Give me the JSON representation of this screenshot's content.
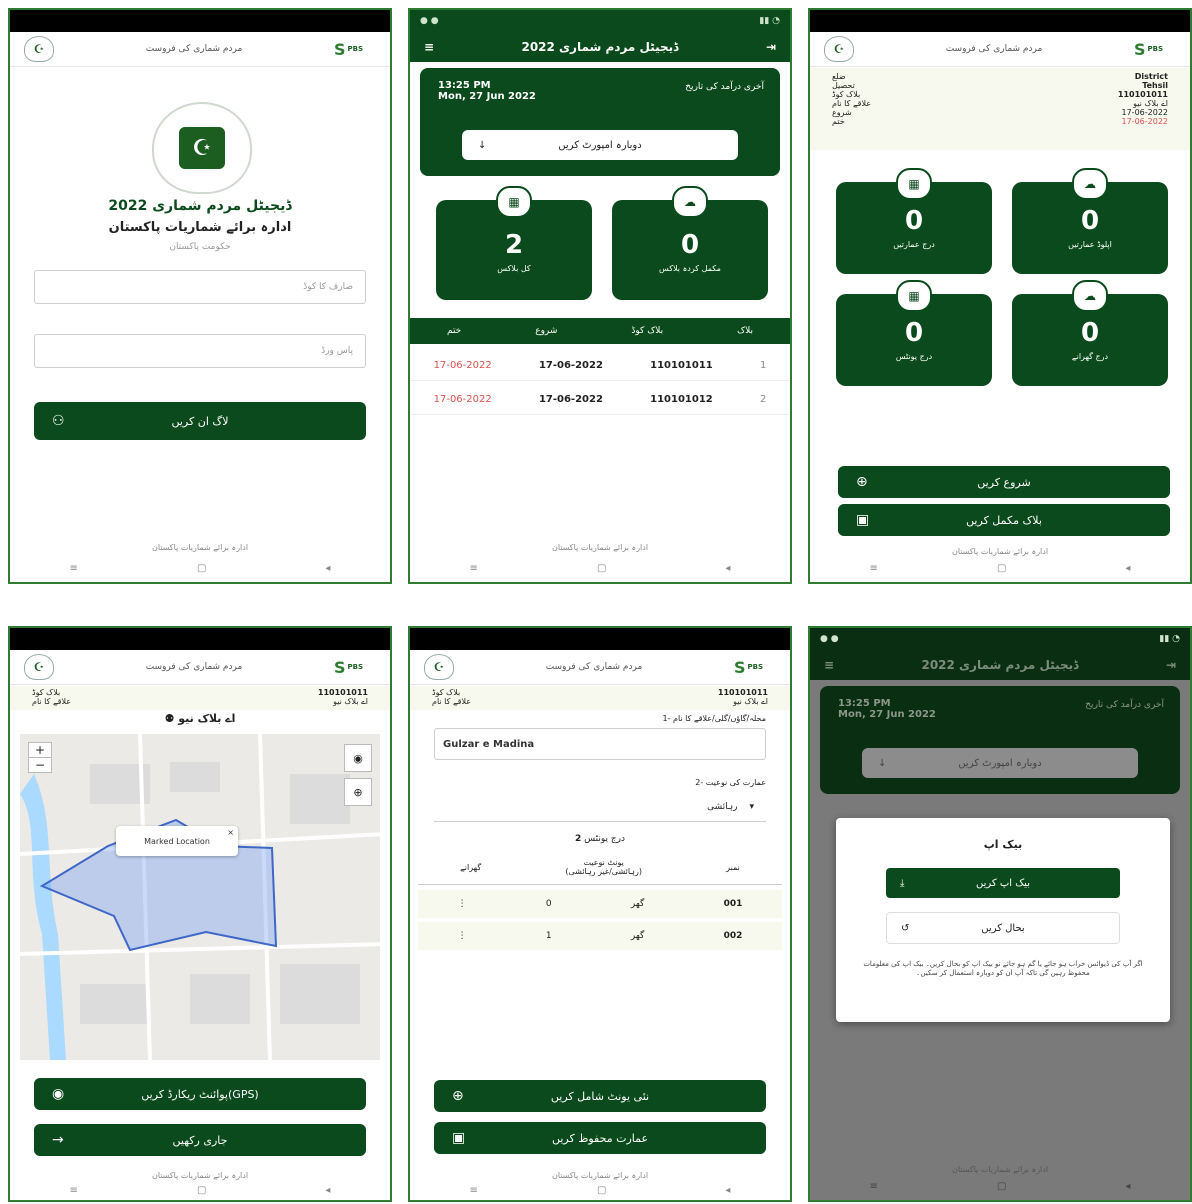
{
  "common": {
    "header_title": "مردم شماری کی فروست",
    "pbs_text": "PBS",
    "footer": "ادارہ برائے شماریات پاکستان",
    "app_title": "ڈیجیٹل مردم شماری 2022"
  },
  "screen1": {
    "title": "ڈیجیٹل مردم شماری 2022",
    "org": "ادارہ برائے شماریات پاکستان",
    "gov": "حکومت پاکستان",
    "username_placeholder": "صارف کا کوڈ",
    "password_placeholder": "پاس ورڈ",
    "login_label": "لاگ ان کریں"
  },
  "screen2": {
    "time": "13:25 PM",
    "date": "Mon, 27 Jun 2022",
    "last_import": "آخری درآمد کی تاریخ",
    "reimport_label": "دوبارہ امپورٹ کریں",
    "card_total_value": "2",
    "card_total_label": "کل بلاکس",
    "card_complete_value": "0",
    "card_complete_label": "مکمل کردہ بلاکس",
    "table_headers": [
      "ختم",
      "شروع",
      "بلاک کوڈ",
      "بلاک"
    ],
    "rows": [
      {
        "end": "17-06-2022",
        "start": "17-06-2022",
        "code": "110101011",
        "idx": "1"
      },
      {
        "end": "17-06-2022",
        "start": "17-06-2022",
        "code": "110101012",
        "idx": "2"
      }
    ]
  },
  "screen3": {
    "info": [
      [
        "ضلع",
        "District"
      ],
      [
        "تحصیل",
        "Tehsil"
      ],
      [
        "بلاک کوڈ",
        "110101011"
      ],
      [
        "علاقے کا نام",
        "اے بلاک نیو"
      ],
      [
        "شروع",
        "17-06-2022"
      ],
      [
        "ختم",
        "17-06-2022"
      ]
    ],
    "cards": [
      {
        "value": "0",
        "label": "درج عمارتیں",
        "icon": "building-icon"
      },
      {
        "value": "0",
        "label": "اپلوڈ عمارتیں",
        "icon": "cloud-upload-icon"
      },
      {
        "value": "0",
        "label": "درج یونٹس",
        "icon": "building-icon"
      },
      {
        "value": "0",
        "label": "درج گھرانے",
        "icon": "cloud-upload-icon"
      }
    ],
    "start_label": "شروع کریں",
    "complete_label": "بلاک مکمل کریں"
  },
  "screen4": {
    "block_code_label": "بلاک کوڈ",
    "block_code_value": "110101011",
    "area_label": "علاقے کا نام",
    "area_value": "اے بلاک نیو",
    "area_name": "اے بلاک نیو",
    "map_popup": "Marked Location",
    "gps_label": "پوائنٹ ریکارڈ کریں(GPS)",
    "continue_label": "جاری رکھیں"
  },
  "screen5": {
    "block_code_label": "بلاک کوڈ",
    "block_code_value": "110101011",
    "area_label": "علاقے کا نام",
    "area_value": "اے بلاک نیو",
    "q1": "1- محلہ/گاؤں/گلی/علاقے کا نام",
    "q1_value": "Gulzar e Madina",
    "q2": "2- عمارت کی نوعیت",
    "q2_value": "رہائشی",
    "units_label": "درج یونٹس",
    "units_count": "2",
    "table_headers": [
      "نمبر",
      "یونٹ نوعیت",
      "گھرانے"
    ],
    "table_sub": "(رہائشی/غیر رہائشی)",
    "rows": [
      {
        "no": "001",
        "type": "گھر",
        "hh": "0"
      },
      {
        "no": "002",
        "type": "گھر",
        "hh": "1"
      }
    ],
    "add_unit_label": "نئی یونٹ شامل کریں",
    "save_label": "عمارت محفوظ کریں"
  },
  "screen6": {
    "dialog_title": "بیک اپ",
    "backup_label": "بیک اپ کریں",
    "restore_label": "بحال کریں",
    "note": "اگر آپ کی ڈیوائس خراب ہو جائے یا گم ہو جائے تو بیک اپ کو بحال کریں۔ بیک اپ کی معلومات محفوظ رہیں گی تاکہ آپ ان کو دوبارہ استعمال کر سکیں۔"
  }
}
